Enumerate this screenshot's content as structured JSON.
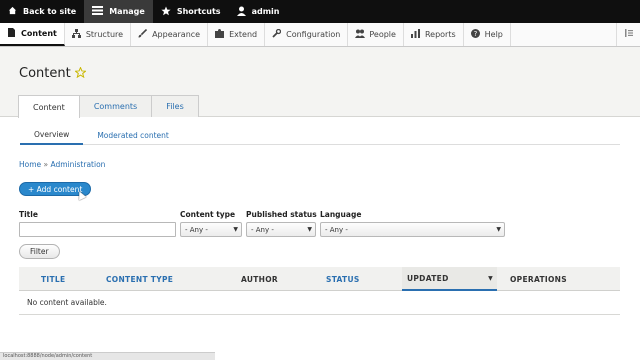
{
  "toolbar": {
    "items": [
      {
        "label": "Back to site",
        "icon": "house-icon"
      },
      {
        "label": "Manage",
        "icon": "menu-icon"
      },
      {
        "label": "Shortcuts",
        "icon": "star-icon"
      },
      {
        "label": "admin",
        "icon": "person-icon"
      }
    ]
  },
  "tray": {
    "items": [
      {
        "label": "Content",
        "icon": "document-icon"
      },
      {
        "label": "Structure",
        "icon": "structure-icon"
      },
      {
        "label": "Appearance",
        "icon": "brush-icon"
      },
      {
        "label": "Extend",
        "icon": "puzzle-icon"
      },
      {
        "label": "Configuration",
        "icon": "wrench-icon"
      },
      {
        "label": "People",
        "icon": "people-icon"
      },
      {
        "label": "Reports",
        "icon": "chart-icon"
      },
      {
        "label": "Help",
        "icon": "help-icon"
      }
    ]
  },
  "page": {
    "title": "Content"
  },
  "tabs": [
    "Content",
    "Comments",
    "Files"
  ],
  "subtabs": [
    "Overview",
    "Moderated content"
  ],
  "breadcrumb": {
    "home": "Home",
    "sep": "»",
    "admin": "Administration"
  },
  "add_button": "+ Add content",
  "filters": {
    "title_label": "Title",
    "title_value": "",
    "content_type_label": "Content type",
    "content_type_value": "- Any -",
    "published_label": "Published status",
    "published_value": "- Any -",
    "language_label": "Language",
    "language_value": "- Any -",
    "filter_button": "Filter"
  },
  "table": {
    "columns": [
      "TITLE",
      "CONTENT TYPE",
      "AUTHOR",
      "STATUS",
      "UPDATED",
      "OPERATIONS"
    ],
    "empty_message": "No content available."
  },
  "status_bar": "localhost:8888/node/admin/content"
}
